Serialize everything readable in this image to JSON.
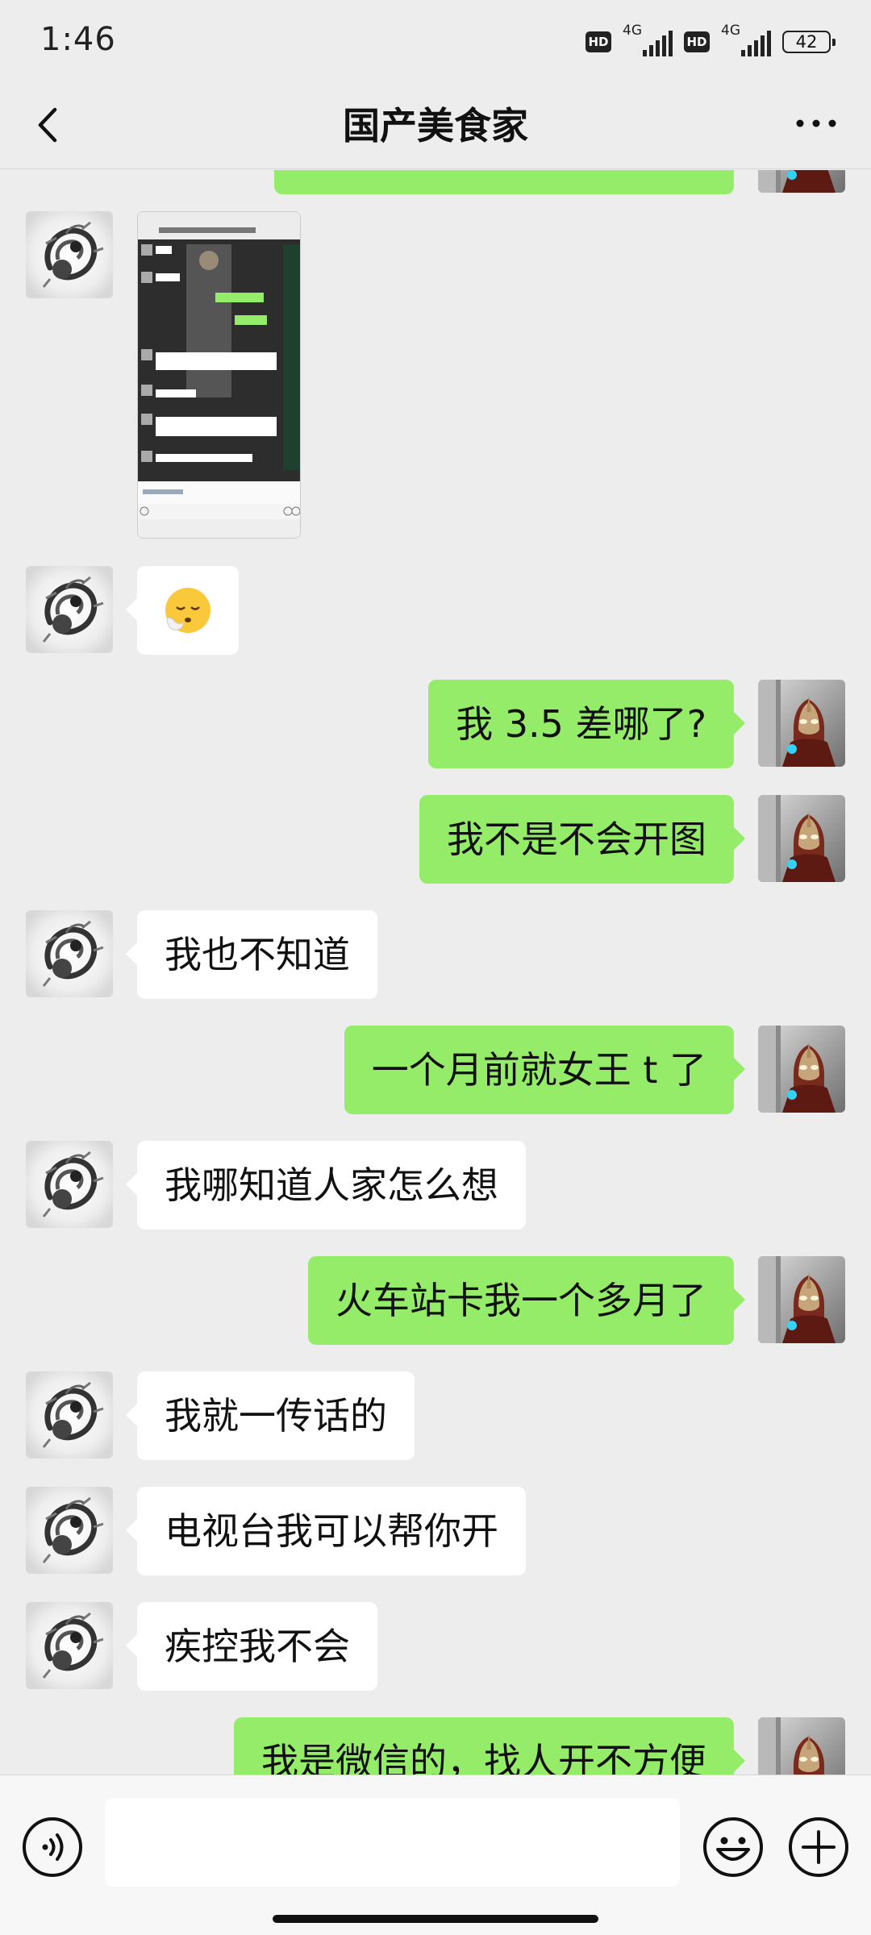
{
  "status_bar": {
    "time": "1:46",
    "hd_label": "HD",
    "network_label": "4G",
    "battery": "42"
  },
  "header": {
    "title": "国产美食家",
    "back_icon": "chevron-left-icon",
    "more_icon": "more-dots-icon"
  },
  "messages": [
    {
      "side": "right",
      "type": "text",
      "text": ""
    },
    {
      "side": "left",
      "type": "image"
    },
    {
      "side": "left",
      "type": "emoji",
      "emoji": "😮‍💨"
    },
    {
      "side": "right",
      "type": "text",
      "text": "我 3.5 差哪了?"
    },
    {
      "side": "right",
      "type": "text",
      "text": "我不是不会开图"
    },
    {
      "side": "left",
      "type": "text",
      "text": "我也不知道"
    },
    {
      "side": "right",
      "type": "text",
      "text": "一个月前就女王 t 了"
    },
    {
      "side": "left",
      "type": "text",
      "text": "我哪知道人家怎么想"
    },
    {
      "side": "right",
      "type": "text",
      "text": "火车站卡我一个多月了"
    },
    {
      "side": "left",
      "type": "text",
      "text": "我就一传话的"
    },
    {
      "side": "left",
      "type": "text",
      "text": "电视台我可以帮你开"
    },
    {
      "side": "left",
      "type": "text",
      "text": "疾控我不会"
    },
    {
      "side": "right",
      "type": "text",
      "text": "我是微信的，找人开不方便"
    }
  ],
  "input_bar": {
    "placeholder": "",
    "voice_icon": "voice-icon",
    "emoji_icon": "emoji-icon",
    "add_icon": "plus-circle-icon"
  },
  "colors": {
    "background": "#ededed",
    "bubble_self": "#95ec69",
    "bubble_other": "#ffffff"
  }
}
